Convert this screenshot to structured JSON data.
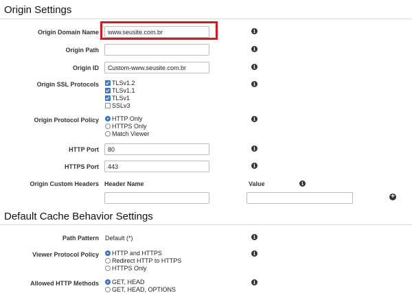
{
  "origin_section": {
    "title": "Origin Settings",
    "domain_name": {
      "label": "Origin Domain Name",
      "value": "www.seusite.com.br"
    },
    "origin_path": {
      "label": "Origin Path",
      "value": ""
    },
    "origin_id": {
      "label": "Origin ID",
      "value": "Custom-www.seusite.com.br"
    },
    "ssl_protocols": {
      "label": "Origin SSL Protocols",
      "options": [
        {
          "label": "TLSv1.2",
          "checked": true
        },
        {
          "label": "TLSv1.1",
          "checked": true
        },
        {
          "label": "TLSv1",
          "checked": true
        },
        {
          "label": "SSLv3",
          "checked": false
        }
      ]
    },
    "protocol_policy": {
      "label": "Origin Protocol Policy",
      "options": [
        {
          "label": "HTTP Only",
          "selected": true
        },
        {
          "label": "HTTPS Only",
          "selected": false
        },
        {
          "label": "Match Viewer",
          "selected": false
        }
      ]
    },
    "http_port": {
      "label": "HTTP Port",
      "value": "80"
    },
    "https_port": {
      "label": "HTTPS Port",
      "value": "443"
    },
    "custom_headers": {
      "label": "Origin Custom Headers",
      "header_name_col": "Header Name",
      "value_col": "Value",
      "header_name_value": "",
      "value_value": ""
    }
  },
  "cache_section": {
    "title": "Default Cache Behavior Settings",
    "path_pattern": {
      "label": "Path Pattern",
      "value": "Default (*)"
    },
    "viewer_protocol_policy": {
      "label": "Viewer Protocol Policy",
      "options": [
        {
          "label": "HTTP and HTTPS",
          "selected": true
        },
        {
          "label": "Redirect HTTP to HTTPS",
          "selected": false
        },
        {
          "label": "HTTPS Only",
          "selected": false
        }
      ]
    },
    "allowed_methods": {
      "label": "Allowed HTTP Methods",
      "options": [
        {
          "label": "GET, HEAD",
          "selected": true
        },
        {
          "label": "GET, HEAD, OPTIONS",
          "selected": false
        }
      ]
    }
  },
  "icons": {
    "info": "info-icon",
    "add": "add-icon"
  },
  "colors": {
    "accent": "#3b7ddd",
    "highlight": "#e0141e"
  }
}
